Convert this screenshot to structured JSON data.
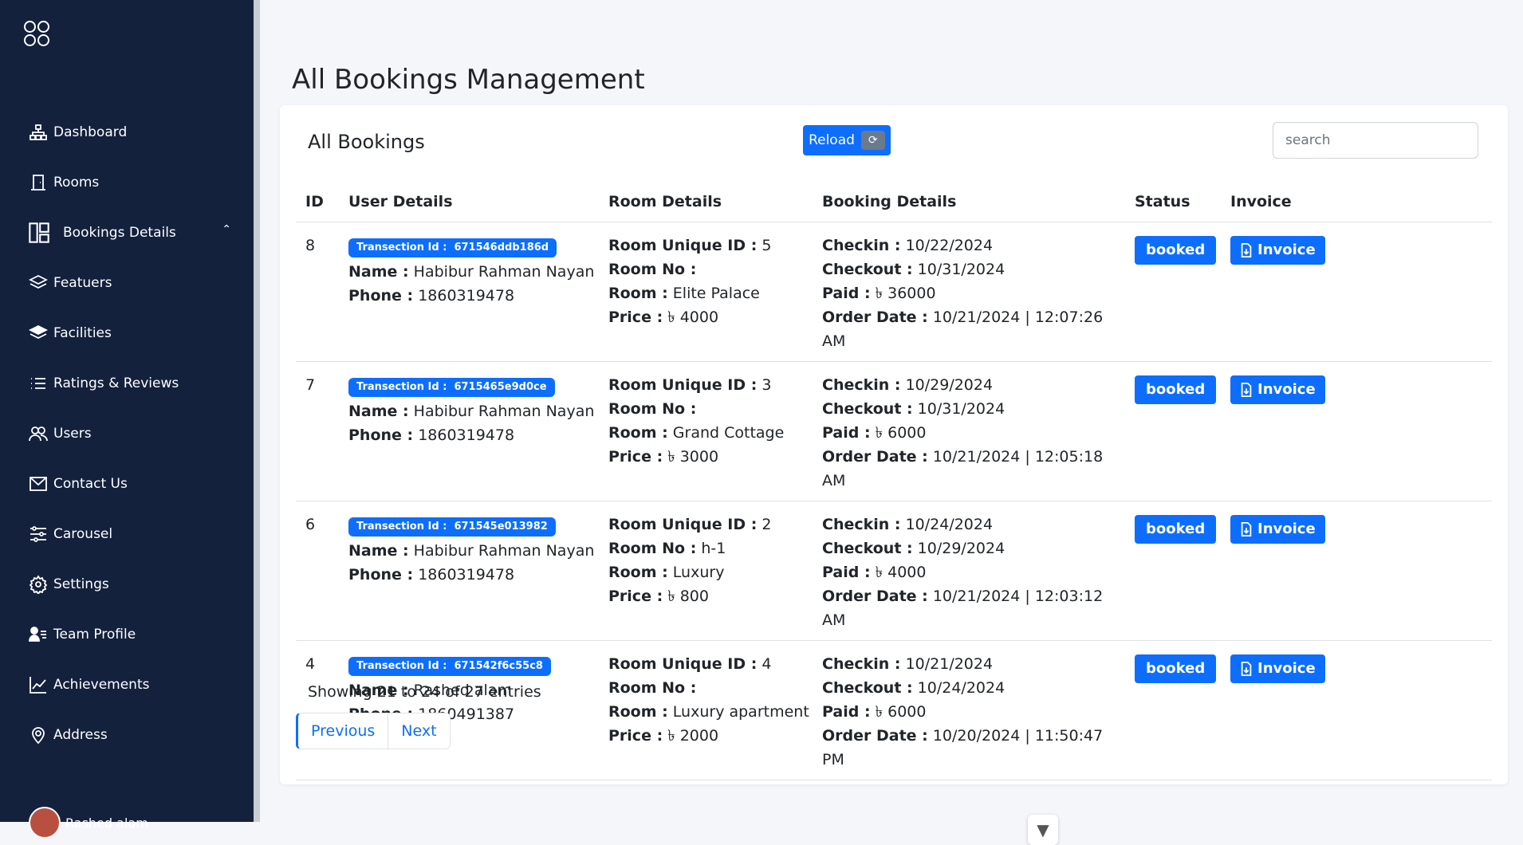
{
  "sidebar": {
    "items": [
      {
        "label": "Dashboard"
      },
      {
        "label": "Rooms"
      },
      {
        "label": "Bookings Details"
      },
      {
        "label": "Featuers"
      },
      {
        "label": "Facilities"
      },
      {
        "label": "Ratings & Reviews"
      },
      {
        "label": "Users"
      },
      {
        "label": "Contact Us"
      },
      {
        "label": "Carousel"
      },
      {
        "label": "Settings"
      },
      {
        "label": "Team Profile"
      },
      {
        "label": "Achievements"
      },
      {
        "label": "Address"
      }
    ],
    "profile_name": "Rashed alam"
  },
  "page": {
    "title": "All Bookings Management"
  },
  "card": {
    "title": "All Bookings",
    "reload_label": "Reload",
    "search_placeholder": "search"
  },
  "table": {
    "headers": [
      "ID",
      "User Details",
      "Room Details",
      "Booking Details",
      "Status",
      "Invoice"
    ],
    "labels": {
      "transaction": "Transection Id :",
      "name": "Name :",
      "phone": "Phone :",
      "room_unique": "Room Unique ID :",
      "room_no": "Room No :",
      "room": "Room :",
      "price": "Price :",
      "checkin": "Checkin :",
      "checkout": "Checkout :",
      "paid": "Paid :",
      "order_date": "Order Date :",
      "invoice": "Invoice"
    },
    "rows": [
      {
        "id": "8",
        "transaction": "671546ddb186d",
        "name": "Habibur Rahman Nayan",
        "phone": "1860319478",
        "room_unique": "5",
        "room_no": "",
        "room": "Elite Palace",
        "price": "৳ 4000",
        "checkin": "10/22/2024",
        "checkout": "10/31/2024",
        "paid": "৳ 36000",
        "order_date": "10/21/2024 | 12:07:26 AM",
        "status": "booked"
      },
      {
        "id": "7",
        "transaction": "6715465e9d0ce",
        "name": "Habibur Rahman Nayan",
        "phone": "1860319478",
        "room_unique": "3",
        "room_no": "",
        "room": "Grand Cottage",
        "price": "৳ 3000",
        "checkin": "10/29/2024",
        "checkout": "10/31/2024",
        "paid": "৳ 6000",
        "order_date": "10/21/2024 | 12:05:18 AM",
        "status": "booked"
      },
      {
        "id": "6",
        "transaction": "671545e013982",
        "name": "Habibur Rahman Nayan",
        "phone": "1860319478",
        "room_unique": "2",
        "room_no": "h-1",
        "room": "Luxury",
        "price": "৳ 800",
        "checkin": "10/24/2024",
        "checkout": "10/29/2024",
        "paid": "৳ 4000",
        "order_date": "10/21/2024 | 12:03:12 AM",
        "status": "booked"
      },
      {
        "id": "4",
        "transaction": "671542f6c55c8",
        "name": "Rashed alam",
        "phone": "1860491387",
        "room_unique": "4",
        "room_no": "",
        "room": "Luxury apartment",
        "price": "৳ 2000",
        "checkin": "10/21/2024",
        "checkout": "10/24/2024",
        "paid": "৳ 6000",
        "order_date": "10/20/2024 | 11:50:47 PM",
        "status": "booked"
      }
    ]
  },
  "footer": {
    "entries_text": "Showing 21 to 24 of 27 entries",
    "prev_label": "Previous",
    "next_label": "Next"
  },
  "colors": {
    "sidebar_bg": "#14213d",
    "accent": "#0d6efd"
  }
}
